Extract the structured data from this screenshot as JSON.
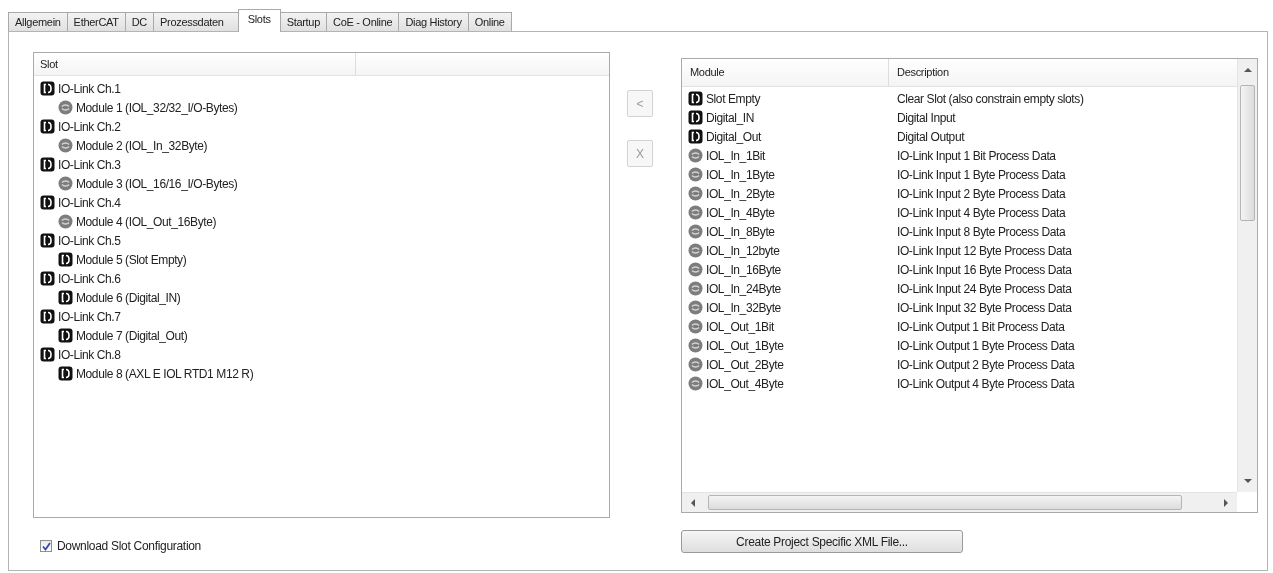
{
  "tabs": [
    {
      "label": "Allgemein",
      "selected": false
    },
    {
      "label": "EtherCAT",
      "selected": false
    },
    {
      "label": "DC",
      "selected": false
    },
    {
      "label": "Prozessdaten",
      "selected": false
    },
    {
      "label": "Slots",
      "selected": true
    },
    {
      "label": "Startup",
      "selected": false
    },
    {
      "label": "CoE - Online",
      "selected": false
    },
    {
      "label": "Diag History",
      "selected": false
    },
    {
      "label": "Online",
      "selected": false
    }
  ],
  "slot_tree": {
    "columns": [
      "Slot"
    ],
    "items": [
      {
        "label": "IO-Link Ch.1",
        "kind": "slot",
        "children": [
          {
            "label": "Module 1 (IOL_32/32_I/O-Bytes)",
            "kind": "module"
          }
        ]
      },
      {
        "label": "IO-Link Ch.2",
        "kind": "slot",
        "children": [
          {
            "label": "Module 2 (IOL_In_32Byte)",
            "kind": "module"
          }
        ]
      },
      {
        "label": "IO-Link Ch.3",
        "kind": "slot",
        "children": [
          {
            "label": "Module 3 (IOL_16/16_I/O-Bytes)",
            "kind": "module"
          }
        ]
      },
      {
        "label": "IO-Link Ch.4",
        "kind": "slot",
        "children": [
          {
            "label": "Module 4 (IOL_Out_16Byte)",
            "kind": "module"
          }
        ]
      },
      {
        "label": "IO-Link Ch.5",
        "kind": "slot",
        "children": [
          {
            "label": "Module 5 (Slot Empty)",
            "kind": "slot"
          }
        ]
      },
      {
        "label": "IO-Link Ch.6",
        "kind": "slot",
        "children": [
          {
            "label": "Module 6 (Digital_IN)",
            "kind": "slot"
          }
        ]
      },
      {
        "label": "IO-Link Ch.7",
        "kind": "slot",
        "children": [
          {
            "label": "Module 7 (Digital_Out)",
            "kind": "slot"
          }
        ]
      },
      {
        "label": "IO-Link Ch.8",
        "kind": "slot",
        "children": [
          {
            "label": "Module 8 (AXL E IOL RTD1 M12 R)",
            "kind": "slot"
          }
        ]
      }
    ]
  },
  "move_buttons": [
    {
      "label": "<",
      "disabled": true
    },
    {
      "label": "X",
      "disabled": true
    }
  ],
  "module_list": {
    "columns": [
      "Module",
      "Description"
    ],
    "rows": [
      {
        "module": "Slot Empty",
        "description": "Clear Slot (also constrain empty slots)",
        "kind": "slot"
      },
      {
        "module": "Digital_IN",
        "description": "Digital Input",
        "kind": "slot"
      },
      {
        "module": "Digital_Out",
        "description": "Digital Output",
        "kind": "slot"
      },
      {
        "module": "IOL_In_1Bit",
        "description": "IO-Link Input 1 Bit Process Data",
        "kind": "module"
      },
      {
        "module": "IOL_In_1Byte",
        "description": "IO-Link Input 1 Byte Process Data",
        "kind": "module"
      },
      {
        "module": "IOL_In_2Byte",
        "description": "IO-Link Input 2 Byte Process Data",
        "kind": "module"
      },
      {
        "module": "IOL_In_4Byte",
        "description": "IO-Link Input 4 Byte Process Data",
        "kind": "module"
      },
      {
        "module": "IOL_In_8Byte",
        "description": "IO-Link Input 8 Byte Process Data",
        "kind": "module"
      },
      {
        "module": "IOL_In_12byte",
        "description": "IO-Link Input 12 Byte Process Data",
        "kind": "module"
      },
      {
        "module": "IOL_In_16Byte",
        "description": "IO-Link Input 16 Byte Process Data",
        "kind": "module"
      },
      {
        "module": "IOL_In_24Byte",
        "description": "IO-Link Input 24 Byte Process Data",
        "kind": "module"
      },
      {
        "module": "IOL_In_32Byte",
        "description": "IO-Link Input 32 Byte Process Data",
        "kind": "module"
      },
      {
        "module": "IOL_Out_1Bit",
        "description": "IO-Link Output 1 Bit Process Data",
        "kind": "module"
      },
      {
        "module": "IOL_Out_1Byte",
        "description": "IO-Link Output 1 Byte Process Data",
        "kind": "module"
      },
      {
        "module": "IOL_Out_2Byte",
        "description": "IO-Link Output 2 Byte Process Data",
        "kind": "module"
      },
      {
        "module": "IOL_Out_4Byte",
        "description": "IO-Link Output 4 Byte Process Data",
        "kind": "module"
      }
    ]
  },
  "download_checkbox": {
    "label": "Download Slot Configuration",
    "checked": true
  },
  "create_button": {
    "label": "Create Project Specific XML File..."
  }
}
